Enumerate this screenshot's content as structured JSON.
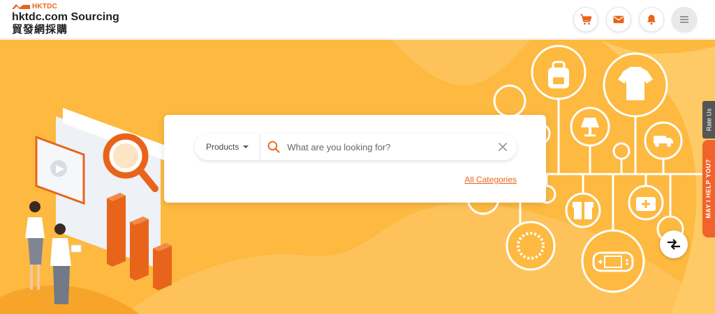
{
  "header": {
    "brand_mark": "HKTDC",
    "title": "hktdc.com Sourcing",
    "subtitle": "貿發網採購",
    "icons": [
      "cart-icon",
      "mail-icon",
      "bell-icon",
      "menu-icon"
    ]
  },
  "search": {
    "type_label": "Products",
    "placeholder": "What are you looking for?",
    "all_categories": "All Categories"
  },
  "side_tabs": {
    "rate_us": "Rate Us",
    "help": "MAY I HELP YOU?"
  },
  "colors": {
    "accent": "#e8641b",
    "hero_bg": "#fdb940",
    "help_tab": "#f0632b"
  }
}
